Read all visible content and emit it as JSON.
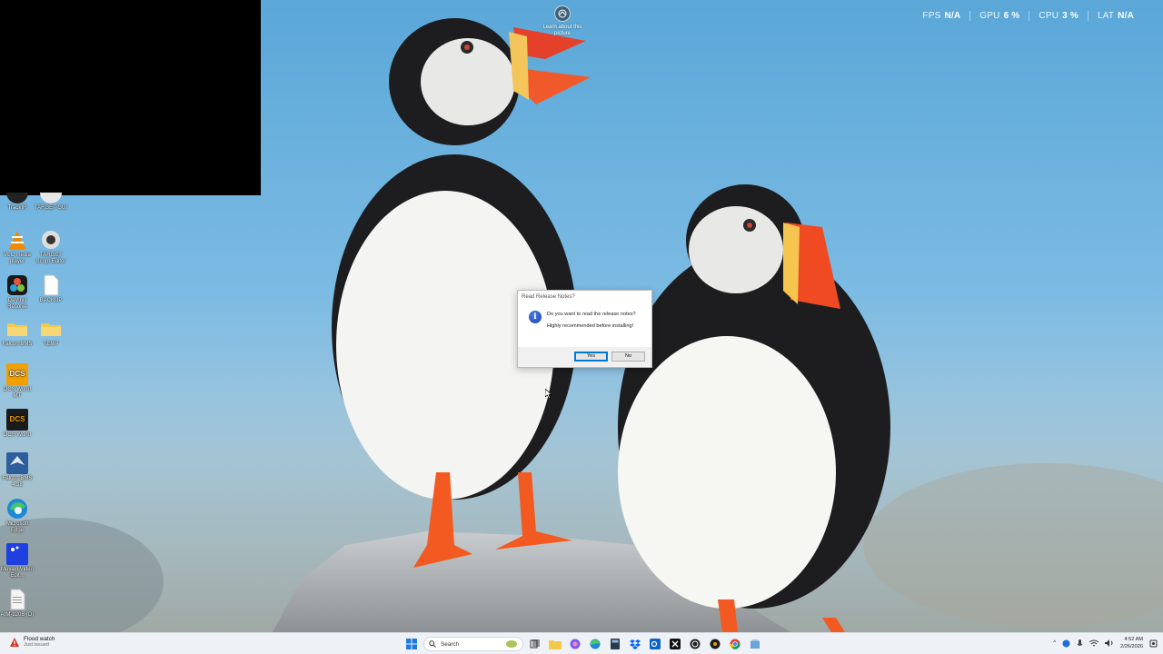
{
  "spotlight": {
    "label": "Learn about this picture"
  },
  "perf": {
    "items": [
      {
        "label": "FPS",
        "value": "N/A"
      },
      {
        "label": "GPU",
        "value": "6 %"
      },
      {
        "label": "CPU",
        "value": "3 %"
      },
      {
        "label": "LAT",
        "value": "N/A"
      }
    ]
  },
  "desktop_icons": [
    {
      "label": "TrackIR",
      "icon": "trackir-icon"
    },
    {
      "label": "TARGET GUI",
      "icon": "target-gui-icon"
    },
    {
      "label": "VLC media player",
      "icon": "vlc-icon"
    },
    {
      "label": "TARGET Script Editor",
      "icon": "target-script-icon"
    },
    {
      "label": "DaVinci Resolve",
      "icon": "davinci-icon"
    },
    {
      "label": "BACKUP",
      "icon": "document-icon"
    },
    {
      "label": "Falcon BMS",
      "icon": "folder-icon"
    },
    {
      "label": "TEMP",
      "icon": "folder-icon"
    },
    {
      "label": "DCS World MT",
      "icon": "dcs-icon"
    },
    {
      "label": "DCS World",
      "icon": "dcs-icon"
    },
    {
      "label": "Falcon BMS 4.38",
      "icon": "bms-icon"
    },
    {
      "label": "Microsoft Edge",
      "icon": "edge-icon"
    },
    {
      "label": "Movavi Video Edit...",
      "icon": "movavi-icon"
    },
    {
      "label": "AIM-120B (D)",
      "icon": "document-icon"
    }
  ],
  "dialog": {
    "title": "Read Release Notes?",
    "message_line1": "Do you want to read the release notes?",
    "message_line2": "Highly recommended before installing!",
    "yes_label": "Yes",
    "no_label": "No"
  },
  "taskbar": {
    "weather_title": "Flood watch",
    "weather_sub": "Just issued",
    "search_placeholder": "Search",
    "clock_time": "4:52 AM",
    "clock_date": "2/26/2026"
  },
  "colors": {
    "sky": "#6fb4e0",
    "taskbar": "#eef2f6",
    "dialog_accent": "#0078d7"
  }
}
